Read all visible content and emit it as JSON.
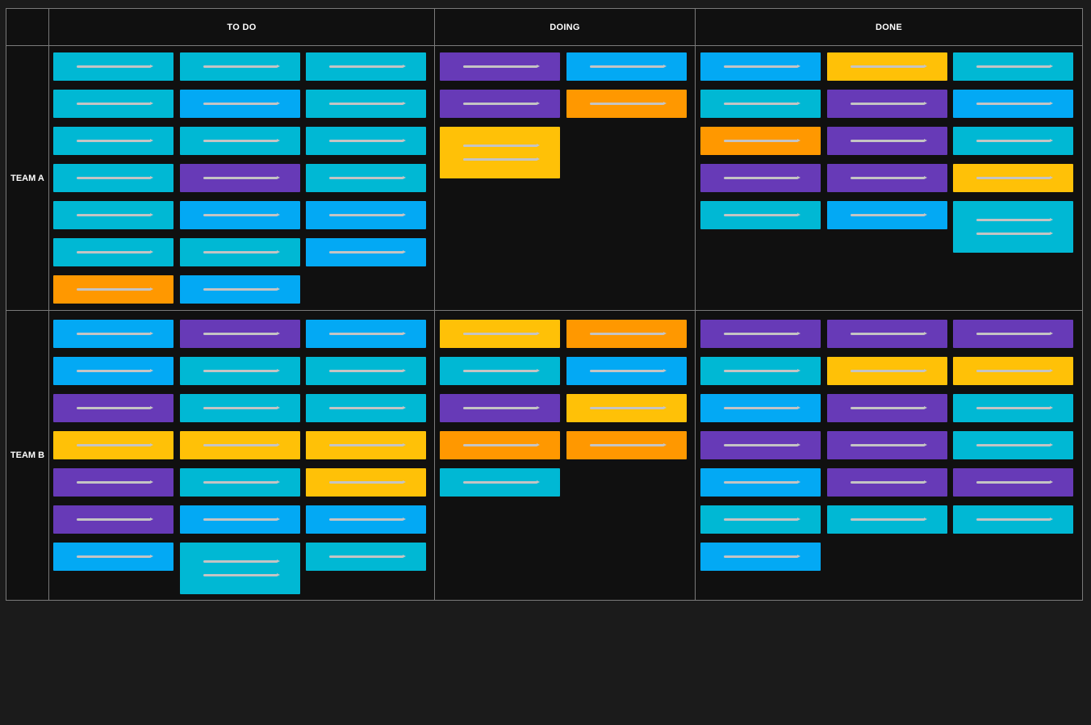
{
  "columns": [
    "TO DO",
    "DOING",
    "DONE"
  ],
  "rows": [
    "TEAM A",
    "TEAM B"
  ],
  "colors": {
    "teal": "#00b8d4",
    "blue": "#03a9f4",
    "purple": "#673ab7",
    "orange": "#ff9800",
    "yellow": "#ffc107"
  },
  "board": {
    "team_a": {
      "todo": [
        "teal",
        "teal",
        "teal",
        "teal",
        "blue",
        "teal",
        "teal",
        "teal",
        "teal",
        "teal",
        "purple",
        "teal",
        "teal",
        "blue",
        "blue",
        "teal",
        "teal",
        "blue",
        "orange",
        "blue"
      ],
      "doing": [
        "purple",
        "blue",
        "purple",
        "orange",
        "yellow*"
      ],
      "done": [
        "blue",
        "yellow",
        "teal",
        "teal",
        "purple",
        "blue",
        "orange",
        "purple",
        "teal",
        "purple",
        "purple",
        "yellow",
        "teal",
        "blue",
        "teal*"
      ]
    },
    "team_b": {
      "todo": [
        "blue",
        "purple",
        "blue",
        "blue",
        "teal",
        "teal",
        "purple",
        "teal",
        "teal",
        "yellow",
        "yellow",
        "yellow",
        "purple",
        "teal",
        "yellow",
        "purple",
        "blue",
        "blue",
        "blue",
        "teal*",
        "teal"
      ],
      "doing": [
        "yellow",
        "orange",
        "teal",
        "blue",
        "purple",
        "yellow",
        "orange",
        "orange",
        "teal"
      ],
      "done": [
        "purple",
        "purple",
        "purple",
        "teal",
        "yellow",
        "yellow",
        "blue",
        "purple",
        "teal",
        "purple",
        "purple",
        "teal",
        "blue",
        "purple",
        "purple",
        "teal",
        "teal",
        "teal",
        "blue"
      ]
    }
  }
}
